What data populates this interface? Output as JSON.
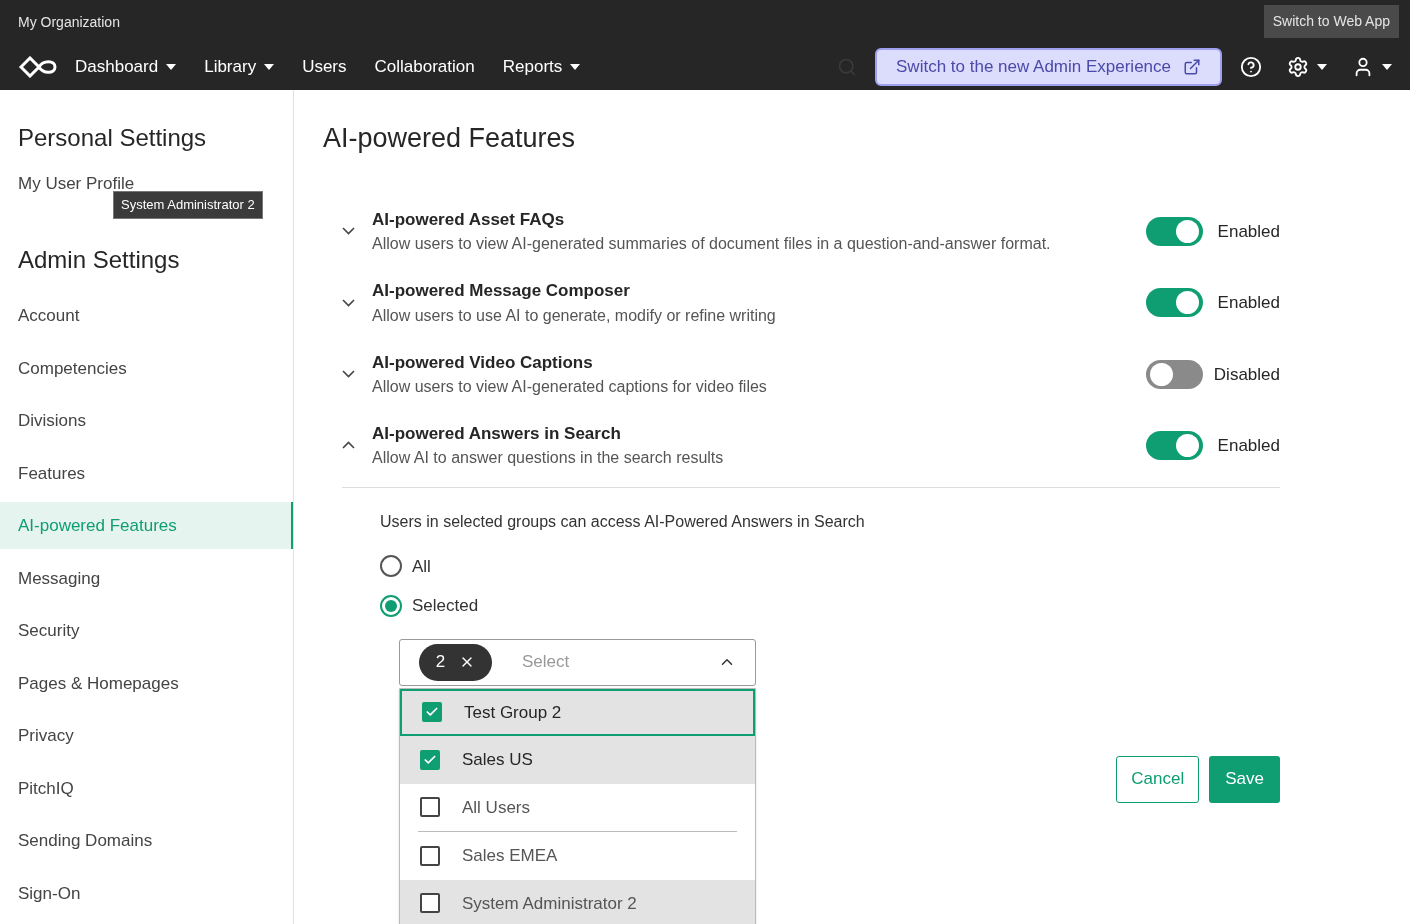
{
  "header": {
    "org": "My Organization",
    "web_app_button": "Switch to Web App",
    "nav": [
      {
        "label": "Dashboard",
        "dropdown": true
      },
      {
        "label": "Library",
        "dropdown": true
      },
      {
        "label": "Users",
        "dropdown": false
      },
      {
        "label": "Collaboration",
        "dropdown": false
      },
      {
        "label": "Reports",
        "dropdown": true
      }
    ],
    "new_admin_button": "Switch to the new Admin Experience"
  },
  "sidebar": {
    "sections": [
      {
        "title": "Personal Settings",
        "items": [
          {
            "label": "My User Profile",
            "selected": false
          }
        ]
      },
      {
        "title": "Admin Settings",
        "items": [
          {
            "label": "Account",
            "selected": false
          },
          {
            "label": "Competencies",
            "selected": false
          },
          {
            "label": "Divisions",
            "selected": false
          },
          {
            "label": "Features",
            "selected": false
          },
          {
            "label": "AI-powered Features",
            "selected": true
          },
          {
            "label": "Messaging",
            "selected": false
          },
          {
            "label": "Security",
            "selected": false
          },
          {
            "label": "Pages & Homepages",
            "selected": false
          },
          {
            "label": "Privacy",
            "selected": false
          },
          {
            "label": "PitchIQ",
            "selected": false
          },
          {
            "label": "Sending Domains",
            "selected": false
          },
          {
            "label": "Sign-On",
            "selected": false
          }
        ]
      }
    ],
    "tooltip": "System Administrator 2"
  },
  "page_title": "AI-powered Features",
  "features": [
    {
      "title": "AI-powered Asset FAQs",
      "description": "Allow users to view AI-generated summaries of document files in a question-and-answer format.",
      "on": true,
      "status": "Enabled",
      "expanded": false
    },
    {
      "title": "AI-powered Message Composer",
      "description": "Allow users to use AI to generate, modify or refine writing",
      "on": true,
      "status": "Enabled",
      "expanded": false
    },
    {
      "title": "AI-powered Video Captions",
      "description": "Allow users to view AI-generated captions for video files",
      "on": false,
      "status": "Disabled",
      "expanded": false
    },
    {
      "title": "AI-powered Answers in Search",
      "description": "Allow AI to answer questions in the search results",
      "on": true,
      "status": "Enabled",
      "expanded": true
    }
  ],
  "access": {
    "prompt": "Users in selected groups can access AI-Powered Answers in Search",
    "options": [
      {
        "label": "All",
        "selected": false
      },
      {
        "label": "Selected",
        "selected": true
      }
    ],
    "select": {
      "count": "2",
      "placeholder": "Select",
      "expanded": true,
      "items": [
        {
          "label": "Test Group 2",
          "checked": true,
          "highlighted": true,
          "focused": true,
          "divider_after": false
        },
        {
          "label": "Sales US",
          "checked": true,
          "highlighted": true,
          "focused": false,
          "divider_after": false
        },
        {
          "label": "All Users",
          "checked": false,
          "highlighted": false,
          "focused": false,
          "divider_after": true
        },
        {
          "label": "Sales EMEA",
          "checked": false,
          "highlighted": false,
          "focused": false,
          "divider_after": false
        },
        {
          "label": "System Administrator 2",
          "checked": false,
          "highlighted": true,
          "focused": false,
          "divider_after": false
        }
      ]
    }
  },
  "buttons": {
    "cancel": "Cancel",
    "save": "Save"
  }
}
